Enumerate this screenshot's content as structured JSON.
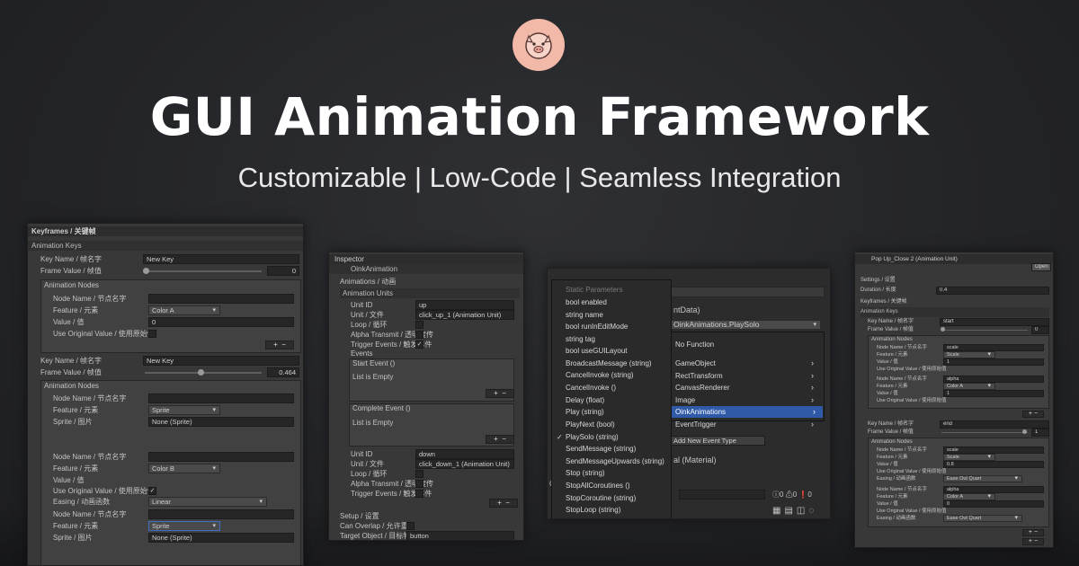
{
  "header": {
    "title": "GUI Animation Framework",
    "subtitle": "Customizable | Low-Code | Seamless Integration"
  },
  "panel1": {
    "title": "Keyframes / 关键帧",
    "section": "Animation Keys",
    "key1": {
      "key_name_label": "Key Name / 帧名字",
      "key_name_value": "New Key",
      "frame_value_label": "Frame Value / 帧值",
      "frame_value": "0",
      "nodes_label": "Animation Nodes",
      "node_name_label": "Node Name / 节点名字",
      "feature_label": "Feature / 元素",
      "feature_value": "Color A",
      "value_label": "Value / 值",
      "value_value": "0",
      "use_original_label": "Use Original Value / 使用原始值"
    },
    "key2": {
      "key_name_label": "Key Name / 帧名字",
      "key_name_value": "New Key",
      "frame_value_label": "Frame Value / 帧值",
      "frame_value": "0.464",
      "nodes_label": "Animation Nodes",
      "node1": {
        "node_name_label": "Node Name / 节点名字",
        "feature_label": "Feature / 元素",
        "feature_value": "Sprite",
        "sprite_label": "Sprite / 图片",
        "sprite_value": "None (Sprite)"
      },
      "node2": {
        "node_name_label": "Node Name / 节点名字",
        "feature_label": "Feature / 元素",
        "feature_value": "Color B",
        "value_label": "Value / 值",
        "use_original_label": "Use Original Value / 使用原始值",
        "easing_label": "Easing / 动画函数",
        "easing_value": "Linear"
      },
      "node3": {
        "node_name_label": "Node Name / 节点名字",
        "feature_label": "Feature / 元素",
        "feature_value": "Sprite",
        "sprite_label": "Sprite / 图片",
        "sprite_value": "None (Sprite)"
      }
    },
    "plus": "+",
    "minus": "−"
  },
  "panel2": {
    "tab": "Inspector",
    "component": "OinkAnimation",
    "animations_label": "Animations / 动画",
    "units_label": "Animation Units",
    "unit1": {
      "id_label": "Unit ID",
      "id_value": "up",
      "file_label": "Unit / 文件",
      "file_value": "click_up_1 (Animation Unit)",
      "loop_label": "Loop / 循环",
      "alpha_label": "Alpha Transmit / 透明度传",
      "trigger_label": "Trigger Events / 触发事件"
    },
    "events_label": "Events",
    "start_event": "Start Event ()",
    "list_empty_1": "List is Empty",
    "complete_event": "Complete Event ()",
    "list_empty_2": "List is Empty",
    "unit2": {
      "id_label": "Unit ID",
      "id_value": "down",
      "file_label": "Unit / 文件",
      "file_value": "click_down_1 (Animation Unit)",
      "loop_label": "Loop / 循环",
      "alpha_label": "Alpha Transmit / 透明度传",
      "trigger_label": "Trigger Events / 触发事件"
    },
    "setup_label": "Setup / 设置",
    "overlap_label": "Can Overlap / 允许重叠",
    "target_label": "Target Object / 目标物体",
    "target_value": "button"
  },
  "panel3": {
    "bg_fragment_1": "ntData)",
    "bg_fragment_2": "OinkAnimations.PlaySolo",
    "bg_fragment_3": "Add New Event Type",
    "bg_fragment_4": "al (Material)",
    "bg_fragment_5": "C",
    "badge_1": "0",
    "badge_2": "0",
    "badge_3": "0",
    "menu_static_header": "Static Parameters",
    "menu_left": [
      "bool enabled",
      "string name",
      "bool runInEditMode",
      "string tag",
      "bool useGUILayout",
      "BroadcastMessage (string)",
      "CancelInvoke (string)",
      "CancelInvoke ()",
      "Delay (float)",
      "Play (string)",
      "PlayNext (bool)",
      "PlaySolo (string)",
      "SendMessage (string)",
      "SendMessageUpwards (string)",
      "Stop (string)",
      "StopAllCoroutines ()",
      "StopCoroutine (string)",
      "StopLoop (string)"
    ],
    "menu_left_checked_index": 11,
    "menu_right": [
      "No Function",
      "GameObject",
      "RectTransform",
      "CanvasRenderer",
      "Image",
      "OinkAnimations",
      "EventTrigger"
    ],
    "menu_right_selected_index": 5,
    "check_mark": "✓",
    "submenu_arrow": "›"
  },
  "panel4": {
    "title": "Pop Up_Close 2 (Animation Unit)",
    "open_button": "Open",
    "settings_label": "Settings / 设置",
    "duration_label": "Duration / 长度",
    "duration_value": "0.4",
    "keyframes_label": "Keyframes / 关键帧",
    "keys_label": "Animation Keys",
    "key1": {
      "name_label": "Key Name / 帧名字",
      "name_value": "start",
      "frame_label": "Frame Value / 帧值",
      "frame_value": "0",
      "nodes_label": "Animation Nodes",
      "n1": {
        "node_label": "Node Name / 节点名字",
        "node_value": "scale",
        "feature_label": "Feature / 元素",
        "feature_value": "Scale",
        "value_label": "Value / 值",
        "value_value": "1",
        "use_label": "Use Original Value / 使用原始值"
      },
      "n2": {
        "node_label": "Node Name / 节点名字",
        "node_value": "alpha",
        "feature_label": "Feature / 元素",
        "feature_value": "Color A",
        "value_label": "Value / 值",
        "value_value": "1",
        "use_label": "Use Original Value / 使用原始值"
      }
    },
    "key2": {
      "name_label": "Key Name / 帧名字",
      "name_value": "end",
      "frame_label": "Frame Value / 帧值",
      "frame_value": "1",
      "nodes_label": "Animation Nodes",
      "n1": {
        "node_label": "Node Name / 节点名字",
        "node_value": "scale",
        "feature_label": "Feature / 元素",
        "feature_value": "Scale",
        "value_label": "Value / 值",
        "value_value": "0.8",
        "use_label": "Use Original Value / 使用原始值",
        "easing_label": "Easing / 动画函数",
        "easing_value": "Ease Out Quart"
      },
      "n2": {
        "node_label": "Node Name / 节点名字",
        "node_value": "alpha",
        "feature_label": "Feature / 元素",
        "feature_value": "Color A",
        "value_label": "Value / 值",
        "value_value": "0",
        "use_label": "Use Original Value / 使用原始值",
        "easing_label": "Easing / 动画函数",
        "easing_value": "Ease Out Quart"
      }
    },
    "plus": "+",
    "minus": "−"
  },
  "colors": {
    "accent": "#2f5aa8",
    "logo_bg": "#f2b8a8",
    "panel_bg": "#383838"
  },
  "icons": {
    "logo": "pig-logo-icon"
  }
}
